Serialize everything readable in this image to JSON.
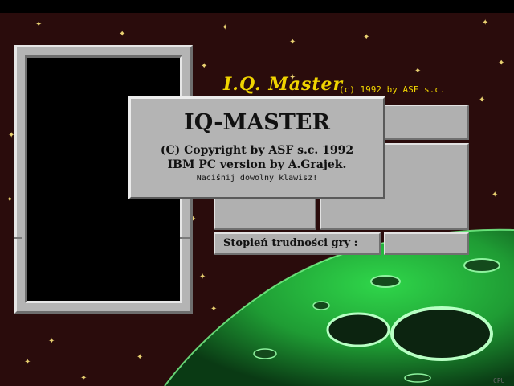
{
  "title": {
    "logo": "I.Q. Master",
    "copyright": "(c) 1992 by ASF s.c."
  },
  "dialog": {
    "title": "IQ-MASTER",
    "copyright": "(C) Copyright by ASF s.c. 1992",
    "version": "IBM PC version by A.Grajek.",
    "prompt": "Naciśnij dowolny klawisz!"
  },
  "difficulty": {
    "label": "Stopień trudności gry :",
    "value": ""
  },
  "footer": {
    "cpu": "CPU"
  },
  "colors": {
    "background": "#2a0c0c",
    "stars": "#e8d070",
    "title": "#f0d400",
    "panel": "#b4b4b4",
    "planet": "#2fd64a"
  }
}
